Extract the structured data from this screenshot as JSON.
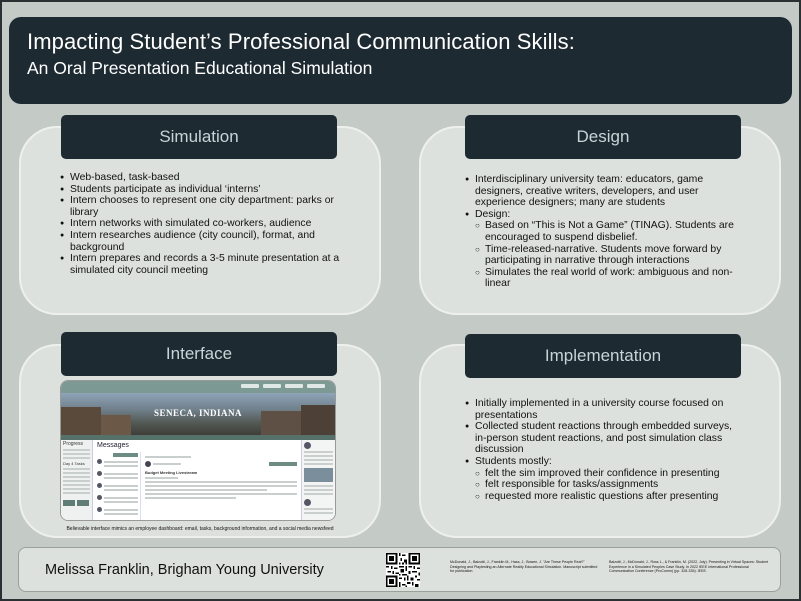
{
  "header": {
    "title": "Impacting Student’s Professional Communication Skills:",
    "subtitle": "An Oral Presentation Educational Simulation"
  },
  "simulation": {
    "title": "Simulation",
    "bullets": [
      "Web-based, task-based",
      "Students participate as individual ‘interns’",
      "Intern chooses to represent one city department: parks or library",
      "Intern networks with simulated co-workers, audience",
      "Intern researches audience (city council), format, and background",
      "Intern prepares and records a 3-5 minute presentation at a simulated city council meeting"
    ]
  },
  "design": {
    "title": "Design",
    "bullets": [
      "Interdisciplinary university team: educators, game designers, creative writers, developers, and user experience designers; many are students",
      "Design:"
    ],
    "sub_bullets": [
      "Based on “This is Not a Game” (TINAG). Students are encouraged to suspend disbelief.",
      "Time-released-narrative. Students move forward by participating in narrative through interactions",
      "Simulates the real world of work: ambiguous and non-linear"
    ]
  },
  "interface": {
    "title": "Interface",
    "town_name": "SENECA, INDIANA",
    "messages_heading": "Messages",
    "progress_heading": "Progress",
    "day_tasks": "Day 4 Tasks",
    "message_subject": "Budget Meeting Livestream",
    "caption": "Believable interface mimics an employee dashboard: email, tasks, background information, and a social media newsfeed"
  },
  "implementation": {
    "title": "Implementation",
    "bullets": [
      "Initially implemented in a university course focused on presentations",
      "Collected student reactions through embedded surveys, in-person student reactions, and post simulation class discussion",
      "Students mostly:"
    ],
    "sub_bullets": [
      "felt the sim improved their confidence in presenting",
      "felt responsible for tasks/assignments",
      "requested more realistic questions after presenting"
    ]
  },
  "footer": {
    "author": "Melissa Franklin, Brigham Young University",
    "reference_1": "McDonald, J., Balzotti, J., Franklin M., Hass, J., Bowen, J. \"Are These People Real?\" Designing and Playtesting an Alternate Reality Educational Simulation. Manuscript submitted for publication.",
    "reference_2": "Balzotti, J., McDonald, J., Ross L., & Franklin, M. (2022, July). Presenting in Virtual Spaces: Student Experience in a Simulated Peoples Case Study. In 2022 IEEE International Professional Communication Conference (ProComm) (pp. 328-335). IEEE."
  },
  "colors": {
    "background": "#c4cac6",
    "header_bg": "#1d2a31",
    "panel_bg": "#dde1de",
    "title_text": "#c8d4d8"
  }
}
